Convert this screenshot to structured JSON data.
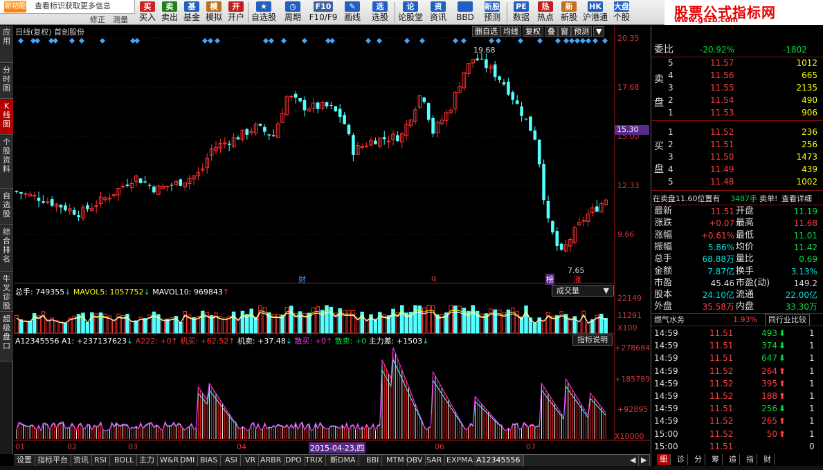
{
  "toolbar": {
    "tip_icon": "新功能",
    "tip": "查看标识获取更多信息",
    "left_items": [
      "修正",
      "测量"
    ],
    "buttons": [
      {
        "label": "买入",
        "icon": "买",
        "color": "#d02020"
      },
      {
        "label": "卖出",
        "icon": "卖",
        "color": "#208020"
      },
      {
        "label": "基金",
        "icon": "基",
        "color": "#2060c0"
      },
      {
        "label": "模拟",
        "icon": "模",
        "color": "#c07020"
      },
      {
        "label": "开户",
        "icon": "开",
        "color": "#c02020"
      },
      {
        "label": "自选股",
        "icon": "★",
        "color": "#2060c0"
      },
      {
        "label": "周期",
        "icon": "◷",
        "color": "#2060c0"
      },
      {
        "label": "F10/F9",
        "icon": "F10",
        "color": "#4060a0"
      },
      {
        "label": "画线",
        "icon": "✎",
        "color": "#2060c0"
      },
      {
        "label": "选股",
        "icon": "选",
        "color": "#2060c0"
      },
      {
        "label": "论股堂",
        "icon": "论",
        "color": "#2060c0"
      },
      {
        "label": "资讯",
        "icon": "资",
        "color": "#2060c0"
      },
      {
        "label": "BBD",
        "icon": "",
        "color": "#2060c0"
      },
      {
        "label": "预测",
        "icon": "新股",
        "color": "#2060c0"
      },
      {
        "label": "数据",
        "icon": "PE",
        "color": "#2060c0"
      },
      {
        "label": "热点",
        "icon": "热",
        "color": "#c02020"
      },
      {
        "label": "新股",
        "icon": "新",
        "color": "#c07020"
      },
      {
        "label": "沪港通",
        "icon": "HK",
        "color": "#2060c0"
      },
      {
        "label": "个股",
        "icon": "大盘",
        "color": "#2060c0"
      }
    ],
    "logo_title": "股票公式指标网",
    "logo_url": "www.gszb.com"
  },
  "left_tabs": [
    {
      "label": "应用",
      "active": false
    },
    {
      "label": "分时图",
      "active": false
    },
    {
      "label": "K线图",
      "active": true
    },
    {
      "label": "个股资料",
      "active": false
    },
    {
      "label": "自选股",
      "active": false
    },
    {
      "label": "综合排名",
      "active": false
    },
    {
      "label": "牛叉诊股",
      "active": false
    },
    {
      "label": "超级盘口",
      "active": false
    }
  ],
  "chart_header": {
    "title": "日线(复权) 首创股份",
    "tools": [
      "删自选",
      "均线",
      "复权",
      "叠",
      "窗",
      "预测"
    ],
    "high_label": "19.68",
    "low_label": "7.65",
    "current_price": "15.30"
  },
  "price_axis": [
    "20.35",
    "17.68",
    "15.00",
    "12.33",
    "9.66"
  ],
  "markers": [
    {
      "text": "财",
      "color": "#3399ff"
    },
    {
      "text": "q",
      "color": "#ff3333"
    },
    {
      "text": "榜",
      "color": "#ffffff"
    },
    {
      "text": "涨",
      "color": "#ff3333"
    }
  ],
  "volume": {
    "legend": [
      {
        "text": "总手: 749355",
        "color": "#ffffff"
      },
      {
        "text": "MAVOL5: 1057752",
        "color": "#ffff00"
      },
      {
        "text": "MAVOL10: 969843",
        "color": "#ffffff"
      }
    ],
    "dropdown": "成交量",
    "axis": [
      "22149",
      "11291",
      "X100"
    ]
  },
  "indicator": {
    "legend": [
      {
        "text": "A12345556",
        "color": "#ffffff"
      },
      {
        "text": "A1: +237137623",
        "color": "#ffffff"
      },
      {
        "text": "A222: +0",
        "color": "#ff3333"
      },
      {
        "text": "机买: +62.52",
        "color": "#ff3333"
      },
      {
        "text": "机卖: +37.48",
        "color": "#ffffff"
      },
      {
        "text": "散买: +0",
        "color": "#ff33ff"
      },
      {
        "text": "散卖: +0",
        "color": "#00e040"
      },
      {
        "text": "主力差: +1503",
        "color": "#ffffff"
      }
    ],
    "button": "指标说明",
    "axis": [
      "+278684",
      "+185789",
      "+92895",
      "X10000"
    ]
  },
  "x_axis": {
    "labels": [
      "01",
      "02",
      "03",
      "04",
      "05",
      "06",
      "07"
    ],
    "cursor_date": "2015-04-23,四"
  },
  "bottom_tabs": [
    "设置",
    "指标平台",
    "资讯",
    "RSI",
    "BOLL",
    "主力",
    "W&R",
    "DMI",
    "BIAS",
    "ASI",
    "VR",
    "ARBR",
    "DPO",
    "TRIX",
    "新DMA",
    "BBI",
    "MTM",
    "OBV",
    "SAR",
    "EXPMA",
    "A12345556"
  ],
  "bottom_active": "A12345556",
  "right_bottom_tabs": [
    "细",
    "诊",
    "分",
    "筹",
    "追",
    "指",
    "财"
  ],
  "order_book": {
    "webi_label": "委比",
    "webi": "-20.92%",
    "webi_diff": "-1802",
    "sell_label": "卖盘",
    "buy_label": "买盘",
    "sells": [
      {
        "level": "5",
        "price": "11.57",
        "vol": "1012"
      },
      {
        "level": "4",
        "price": "11.56",
        "vol": "665"
      },
      {
        "level": "3",
        "price": "11.55",
        "vol": "2135"
      },
      {
        "level": "2",
        "price": "11.54",
        "vol": "490"
      },
      {
        "level": "1",
        "price": "11.53",
        "vol": "906"
      }
    ],
    "buys": [
      {
        "level": "1",
        "price": "11.52",
        "vol": "236"
      },
      {
        "level": "2",
        "price": "11.51",
        "vol": "256"
      },
      {
        "level": "3",
        "price": "11.50",
        "vol": "1473"
      },
      {
        "level": "4",
        "price": "11.49",
        "vol": "439"
      },
      {
        "level": "5",
        "price": "11.48",
        "vol": "1002"
      }
    ],
    "notice_left": "在卖盘11.60位置有",
    "notice_vol": "3487手",
    "notice_right": "卖单!",
    "notice_link": "查看详细"
  },
  "quote": [
    {
      "l1": "最新",
      "v1": "11.51",
      "c1": "red",
      "l2": "开盘",
      "v2": "11.19",
      "c2": "green"
    },
    {
      "l1": "涨跌",
      "v1": "+0.07",
      "c1": "red",
      "l2": "最高",
      "v2": "11.68",
      "c2": "red"
    },
    {
      "l1": "涨幅",
      "v1": "+0.61%",
      "c1": "red",
      "l2": "最低",
      "v2": "11.01",
      "c2": "green"
    },
    {
      "l1": "振幅",
      "v1": "5.86%",
      "c1": "cyan",
      "l2": "均价",
      "v2": "11.42",
      "c2": "green"
    },
    {
      "l1": "总手",
      "v1": "68.88万",
      "c1": "cyan",
      "l2": "量比",
      "v2": "0.69",
      "c2": "green"
    },
    {
      "l1": "金额",
      "v1": "7.87亿",
      "c1": "cyan",
      "l2": "换手",
      "v2": "3.13%",
      "c2": "cyan"
    },
    {
      "l1": "市盈",
      "v1": "45.46",
      "c1": "white",
      "l2": "市盈(动)",
      "v2": "149.2",
      "c2": "white"
    },
    {
      "l1": "股本",
      "v1": "24.10亿",
      "c1": "cyan",
      "l2": "流通",
      "v2": "22.00亿",
      "c2": "cyan"
    },
    {
      "l1": "外盘",
      "v1": "35.58万",
      "c1": "red",
      "l2": "内盘",
      "v2": "33.30万",
      "c2": "green"
    }
  ],
  "industry": {
    "name": "燃气水务",
    "pct": "1.93%",
    "button": "同行业比较"
  },
  "ticks": [
    {
      "time": "14:59",
      "price": "11.51",
      "vol": "493",
      "dir": "down",
      "n": "1"
    },
    {
      "time": "14:59",
      "price": "11.51",
      "vol": "374",
      "dir": "down",
      "n": "1"
    },
    {
      "time": "14:59",
      "price": "11.51",
      "vol": "647",
      "dir": "down",
      "n": "1"
    },
    {
      "time": "14:59",
      "price": "11.52",
      "vol": "264",
      "dir": "up",
      "n": "1"
    },
    {
      "time": "14:59",
      "price": "11.52",
      "vol": "395",
      "dir": "up",
      "n": "1"
    },
    {
      "time": "14:59",
      "price": "11.52",
      "vol": "188",
      "dir": "up",
      "n": "1"
    },
    {
      "time": "14:59",
      "price": "11.51",
      "vol": "256",
      "dir": "down",
      "n": "1"
    },
    {
      "time": "14:59",
      "price": "11.52",
      "vol": "265",
      "dir": "up",
      "n": "1"
    },
    {
      "time": "15:00",
      "price": "11.52",
      "vol": "50",
      "dir": "up",
      "n": "1"
    },
    {
      "time": "15:00",
      "price": "11.51",
      "vol": "",
      "dir": "",
      "n": "0"
    }
  ]
}
